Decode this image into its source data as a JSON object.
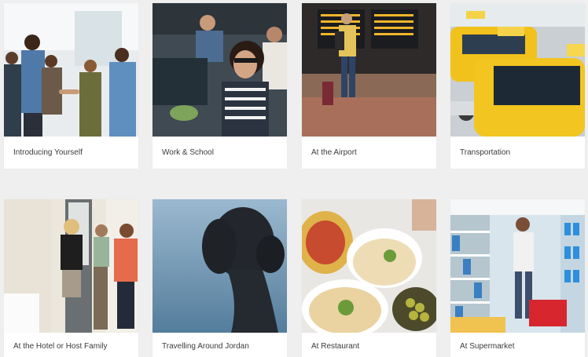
{
  "cards": [
    {
      "title": "Introducing Yourself",
      "image": "people-handshake-image"
    },
    {
      "title": "Work & School",
      "image": "student-smiling-image"
    },
    {
      "title": "At the Airport",
      "image": "airport-traveler-image"
    },
    {
      "title": "Transportation",
      "image": "taxi-cars-image"
    },
    {
      "title": "At the Hotel or Host Family",
      "image": "hotel-door-greeting-image"
    },
    {
      "title": "Travelling Around Jordan",
      "image": "dead-sea-mud-image"
    },
    {
      "title": "At Restaurant",
      "image": "middle-eastern-food-image"
    },
    {
      "title": "At Supermarket",
      "image": "supermarket-aisle-image"
    }
  ],
  "colors": {
    "page_bg": "#efefef",
    "card_bg": "#ffffff",
    "label_text": "#3b3b3b"
  }
}
